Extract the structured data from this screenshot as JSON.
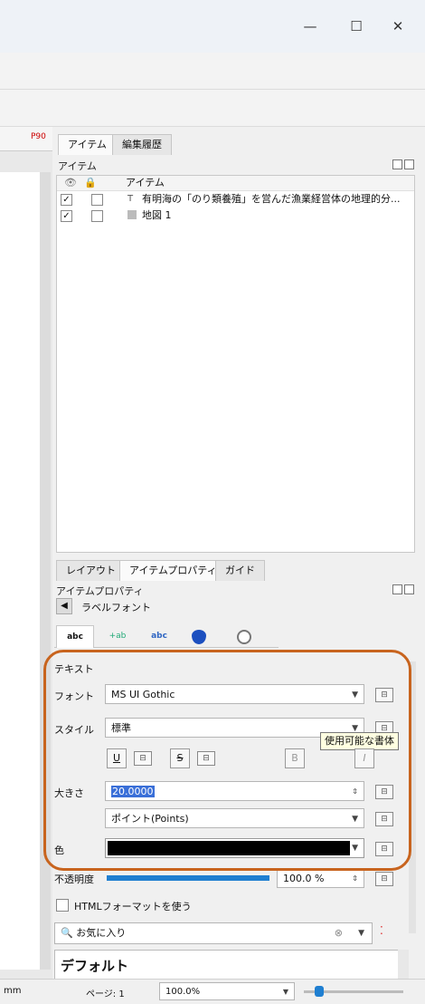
{
  "window": {
    "minimize_glyph": "—",
    "maximize_glyph": "☐",
    "close_glyph": "✕"
  },
  "ruler": {
    "label": "P90"
  },
  "dock_tabs": [
    "アイテム",
    "編集履歴"
  ],
  "items_panel": {
    "title": "アイテム",
    "column_header": "アイテム",
    "rows": [
      {
        "checked": "✓",
        "label": "有明海の「のり類養殖」を営んだ漁業経営体の地理的分...",
        "icon": "text-item-icon"
      },
      {
        "checked": "✓",
        "label": "地図 1",
        "icon": "map-item-icon"
      }
    ]
  },
  "bottom_tabs": [
    "レイアウト",
    "アイテムプロパティ",
    "ガイド"
  ],
  "properties_panel": {
    "title": "アイテムプロパティ",
    "back_label": "ラベルフォント",
    "subtabs": [
      "abc",
      "+ab",
      "abc",
      "",
      ""
    ],
    "section_label": "テキスト",
    "font_label": "フォント",
    "font_value": "MS UI Gothic",
    "style_label": "スタイル",
    "style_value": "標準",
    "tooltip": "使用可能な書体",
    "format_buttons": [
      "U",
      "S",
      "B",
      "I"
    ],
    "size_label": "大きさ",
    "size_value": "20.0000",
    "unit_value": "ポイント(Points)",
    "color_label": "色",
    "color_value": "#000000",
    "opacity_label": "不透明度",
    "opacity_value": "100.0 %",
    "opacity_fraction": 1.0,
    "html_checkbox_label": "HTMLフォーマットを使う",
    "favorites_placeholder": "お気に入り",
    "default_label": "デフォルト"
  },
  "statusbar": {
    "unit": "mm",
    "page_label": "ページ: 1",
    "zoom_value": "100.0%"
  },
  "colors": {
    "highlight": "#c8641e",
    "accent": "#1f7fd1"
  }
}
